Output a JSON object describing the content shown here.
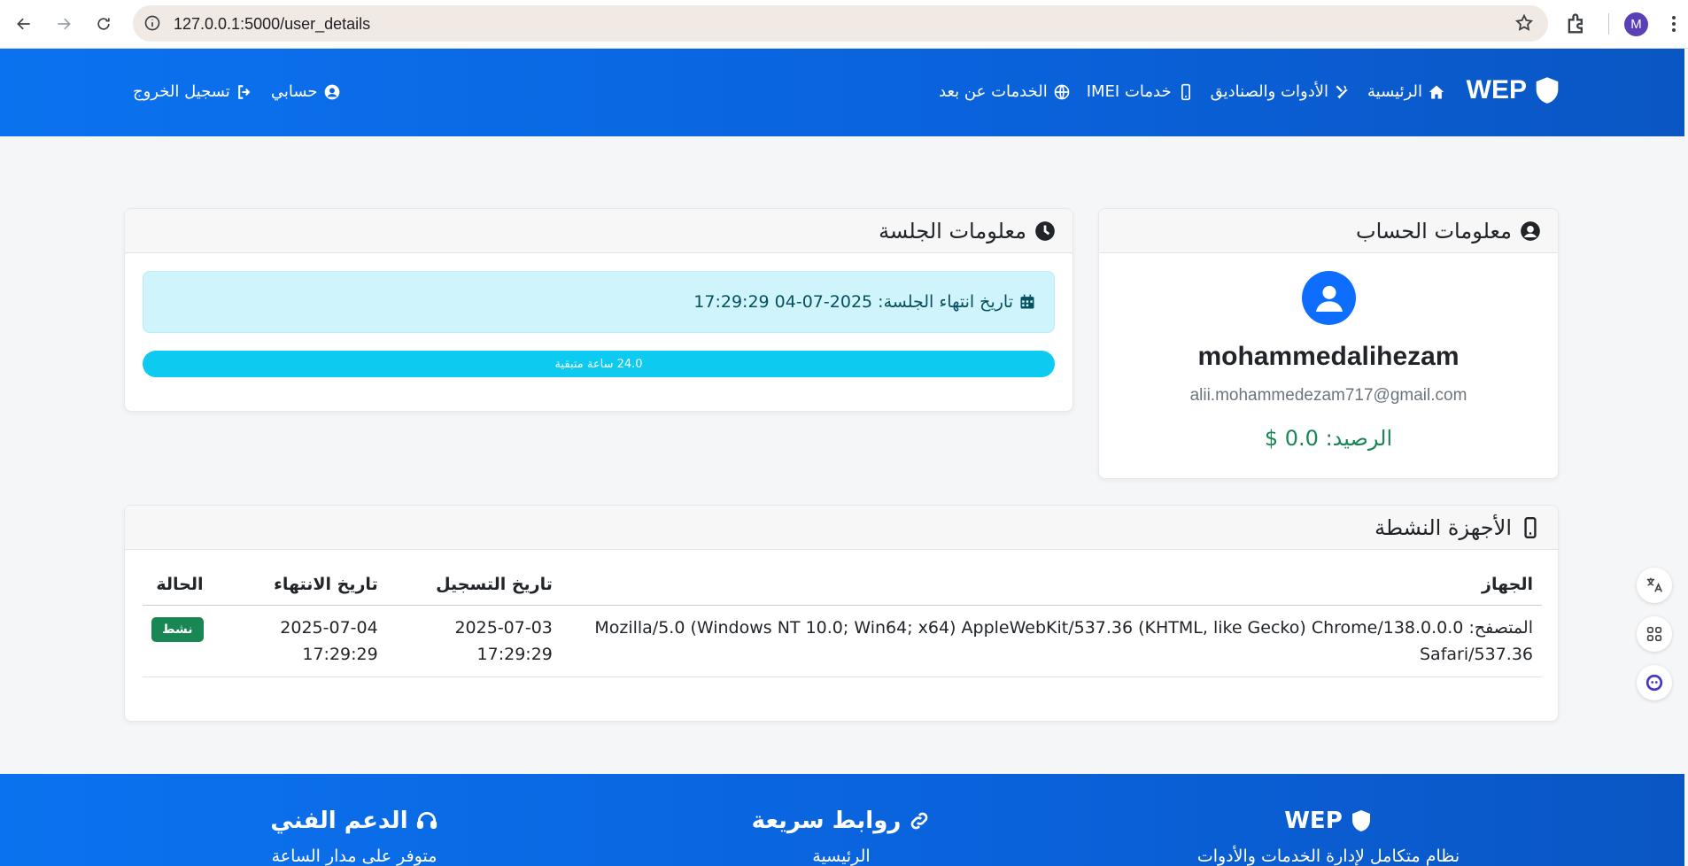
{
  "browser": {
    "url": "127.0.0.1:5000/user_details",
    "profile_initial": "M"
  },
  "navbar": {
    "brand": "WEP",
    "links": [
      {
        "label": "الرئيسية",
        "icon": "home-icon"
      },
      {
        "label": "الأدوات والصناديق",
        "icon": "tools-icon"
      },
      {
        "label": "خدمات IMEI",
        "icon": "mobile-icon"
      },
      {
        "label": "الخدمات عن بعد",
        "icon": "globe-icon"
      }
    ],
    "account_label": "حسابي",
    "logout_label": "تسجيل الخروج"
  },
  "account_card": {
    "title": "معلومات الحساب",
    "username": "mohammedalihezam",
    "email": "alii.mohammedezam717@gmail.com",
    "balance": "الرصيد: 0.0 $"
  },
  "session_card": {
    "title": "معلومات الجلسة",
    "expiry_text": "تاريخ انتهاء الجلسة: 2025-07-04 17:29:29",
    "remaining_label": "24.0 ساعة متبقية",
    "progress_percent": 100
  },
  "devices_card": {
    "title": "الأجهزة النشطة",
    "headers": [
      "الجهاز",
      "تاريخ التسجيل",
      "تاريخ الانتهاء",
      "الحالة"
    ],
    "rows": [
      {
        "device": "المتصفح: Mozilla/5.0 (Windows NT 10.0; Win64; x64) AppleWebKit/537.36 (KHTML, like Gecko) Chrome/138.0.0.0 Safari/537.36",
        "registered": "2025-07-03 17:29:29",
        "expires": "2025-07-04 17:29:29",
        "status": "نشط"
      }
    ]
  },
  "footer": {
    "brand_title": "WEP",
    "brand_desc": "نظام متكامل لإدارة الخدمات والأدوات",
    "links_title": "روابط سريعة",
    "links_first": "الرئيسية",
    "support_title": "الدعم الفني",
    "support_desc": "متوفر على مدار الساعة"
  },
  "colors": {
    "primary": "#0b72ef",
    "success": "#198754",
    "info": "#0dcaf0"
  }
}
